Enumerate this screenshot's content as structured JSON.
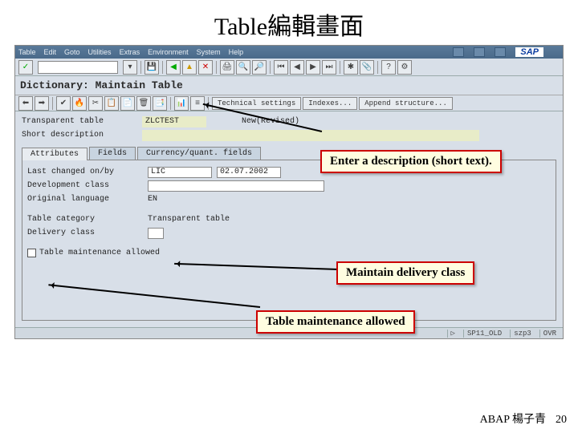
{
  "slide": {
    "title": "Table編輯畫面",
    "footer": "ABAP 楊子青",
    "page": "20"
  },
  "menu": {
    "items": [
      "Table",
      "Edit",
      "Goto",
      "Utilities",
      "Extras",
      "Environment",
      "System",
      "Help"
    ],
    "logo": "SAP"
  },
  "toolbar": {
    "green_check": "✓",
    "save": "💾",
    "back": "◀",
    "up": "▲",
    "cancel": "✕",
    "print": "🖨",
    "find": "🔍",
    "findnext": "🔎",
    "first": "⏮",
    "prev": "◀",
    "next": "▶",
    "last": "⏭",
    "new": "✱",
    "help": "?"
  },
  "screen": {
    "title": "Dictionary: Maintain Table"
  },
  "apptb": {
    "btns": [
      "⬅",
      "➡",
      "",
      "🔧",
      "✂",
      "📋",
      "📄",
      "🗑",
      "📑",
      "",
      "📊",
      "📋"
    ],
    "tech": "Technical settings",
    "idx": "Indexes...",
    "app": "Append structure..."
  },
  "header": {
    "type_lbl": "Transparent table",
    "type_val": "ZLCTEST",
    "status": "New(Revised)",
    "desc_lbl": "Short description",
    "desc_val": ""
  },
  "tabs": {
    "t1": "Attributes",
    "t2": "Fields",
    "t3": "Currency/quant. fields"
  },
  "attrs": {
    "changed_lbl": "Last changed on/by",
    "changed_by": "LIC",
    "changed_on": "02.07.2002",
    "devclass_lbl": "Development class",
    "devclass": "",
    "lang_lbl": "Original language",
    "lang": "EN",
    "cat_lbl": "Table category",
    "cat": "Transparent table",
    "deliv_lbl": "Delivery class",
    "deliv": "",
    "maint_lbl": "Table maintenance allowed"
  },
  "callouts": {
    "c1": "Enter a description (short text).",
    "c2": "Maintain delivery class",
    "c3": "Table maintenance allowed"
  },
  "status": {
    "s1": "SP11_OLD",
    "s2": "szp3",
    "s3": "OVR"
  }
}
